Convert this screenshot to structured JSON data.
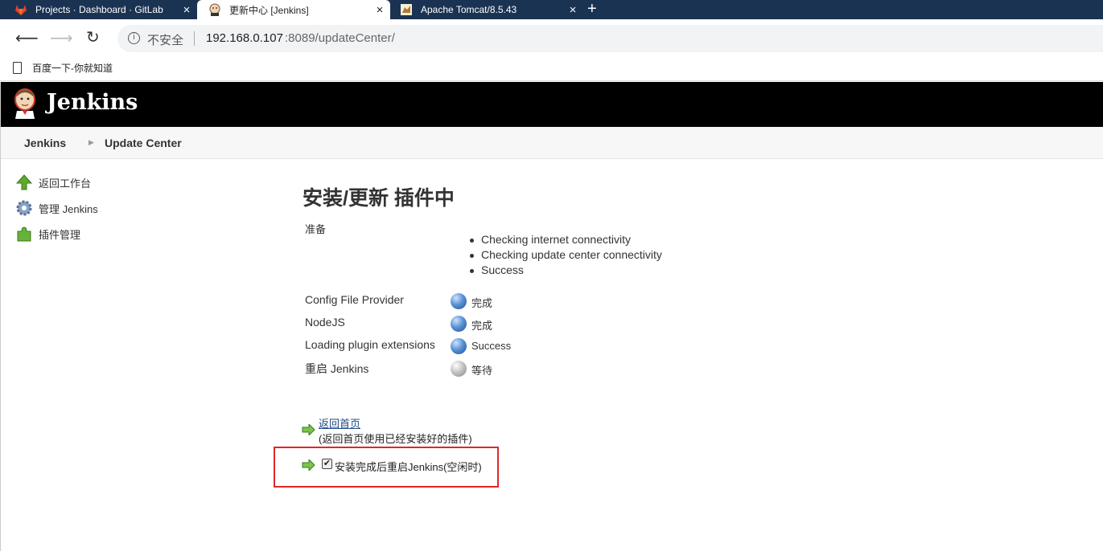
{
  "browser": {
    "tabs": [
      {
        "title": "Projects · Dashboard · GitLab",
        "icon": "gitlab-icon",
        "active": false
      },
      {
        "title": "更新中心 [Jenkins]",
        "icon": "jenkins-icon",
        "active": true
      },
      {
        "title": "Apache Tomcat/8.5.43",
        "icon": "tomcat-icon",
        "active": false
      }
    ],
    "new_tab": "+",
    "close": "×",
    "security_label": "不安全",
    "url_host": "192.168.0.107",
    "url_rest": ":8089/updateCenter/",
    "bookmark": "百度一下-你就知道"
  },
  "jenkins": {
    "title": "Jenkins",
    "breadcrumbs": [
      "Jenkins",
      "Update Center"
    ],
    "sidebar": [
      {
        "label": "返回工作台",
        "icon": "up-arrow-icon"
      },
      {
        "label": "管理 Jenkins",
        "icon": "gear-icon"
      },
      {
        "label": "插件管理",
        "icon": "puzzle-icon"
      }
    ]
  },
  "main": {
    "title": "安装/更新 插件中",
    "prep_label": "准备",
    "checks": [
      "Checking internet connectivity",
      "Checking update center connectivity",
      "Success"
    ],
    "plugins": [
      {
        "name": "Config File Provider",
        "status": "完成",
        "ball": "blue"
      },
      {
        "name": "NodeJS",
        "status": "完成",
        "ball": "blue"
      },
      {
        "name": "Loading plugin extensions",
        "status": "Success",
        "ball": "blue"
      },
      {
        "name": "重启 Jenkins",
        "status": "等待",
        "ball": "grey"
      }
    ],
    "back_link": "返回首页",
    "back_note": "(返回首页使用已经安装好的插件)",
    "restart_label": "安装完成后重启Jenkins(空闲时)",
    "restart_checked": true
  },
  "colors": {
    "tabbar": "#1b3353",
    "header": "#000000",
    "highlight": "#e02727",
    "link": "#204a87"
  }
}
